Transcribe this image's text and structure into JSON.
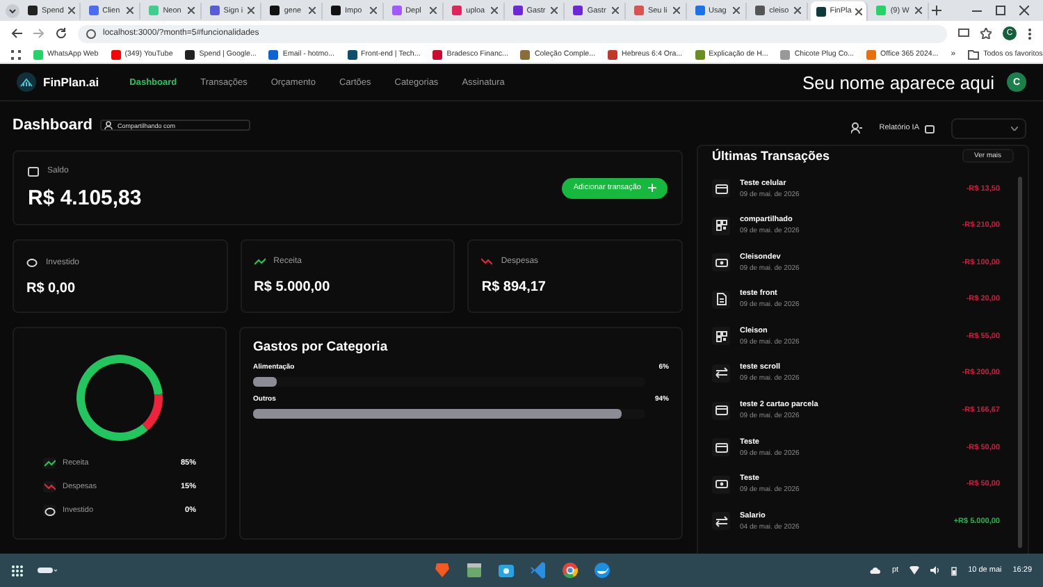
{
  "browser": {
    "tabs": [
      {
        "title": "Spend",
        "color": "#222222",
        "selected": false
      },
      {
        "title": "Clien",
        "color": "#4a6cf7",
        "selected": false
      },
      {
        "title": "Neon",
        "color": "#3ecf8e",
        "selected": false
      },
      {
        "title": "Sign i",
        "color": "#5b5bd6",
        "selected": false
      },
      {
        "title": "gene",
        "color": "#111111",
        "selected": false
      },
      {
        "title": "Impo",
        "color": "#111111",
        "selected": false
      },
      {
        "title": "Depl",
        "color": "#a259ff",
        "selected": false
      },
      {
        "title": "uploa",
        "color": "#e0245e",
        "selected": false
      },
      {
        "title": "Gastr",
        "color": "#6d28d9",
        "selected": false
      },
      {
        "title": "Gastr",
        "color": "#6d28d9",
        "selected": false
      },
      {
        "title": "Seu li",
        "color": "#d9534f",
        "selected": false
      },
      {
        "title": "Usag",
        "color": "#1a73e8",
        "selected": false
      },
      {
        "title": "cleiso",
        "color": "#555555",
        "selected": false
      },
      {
        "title": "FinPla",
        "color": "#0f3a3a",
        "selected": true
      },
      {
        "title": "(9) W",
        "color": "#25d366",
        "selected": false
      }
    ],
    "url": "localhost:3000/?month=5#funcionalidades",
    "profile": "C",
    "bookmarks": [
      {
        "label": "WhatsApp Web",
        "color": "#25d366"
      },
      {
        "label": "(349) YouTube",
        "color": "#ff0000"
      },
      {
        "label": "Spend | Google...",
        "color": "#222222"
      },
      {
        "label": "Email - hotmo...",
        "color": "#0a64d6"
      },
      {
        "label": "Front-end | Tech...",
        "color": "#0b4f6c"
      },
      {
        "label": "Bradesco Financ...",
        "color": "#cc092f"
      },
      {
        "label": "Coleção Comple...",
        "color": "#8a6d3b"
      },
      {
        "label": "Hebreus 6:4 Ora...",
        "color": "#c0392b"
      },
      {
        "label": "Explicação de H...",
        "color": "#6b8e23"
      },
      {
        "label": "Chicote Plug Co...",
        "color": "#999999"
      },
      {
        "label": "Office 365 2024...",
        "color": "#e8700a"
      }
    ],
    "more": "»",
    "all_bookmarks": "Todos os favoritos"
  },
  "app": {
    "brand": "FinPlan.ai",
    "nav": [
      {
        "label": "Dashboard",
        "selected": true
      },
      {
        "label": "Transações",
        "selected": false
      },
      {
        "label": "Orçamento",
        "selected": false
      },
      {
        "label": "Cartões",
        "selected": false
      },
      {
        "label": "Categorias",
        "selected": false
      },
      {
        "label": "Assinatura",
        "selected": false
      }
    ],
    "user_name": "Seu nome aparece aqui",
    "avatar": "C"
  },
  "header": {
    "title": "Dashboard",
    "share_placeholder": "Compartilhando com",
    "report_button": "Relatório IA"
  },
  "balance": {
    "label": "Saldo",
    "value": "R$ 4.105,83",
    "add_button": "Adicionar transação"
  },
  "summary": [
    {
      "kind": "invested",
      "label": "Investido",
      "value": "R$ 0,00"
    },
    {
      "kind": "income",
      "label": "Receita",
      "value": "R$ 5.000,00"
    },
    {
      "kind": "expense",
      "label": "Despesas",
      "value": "R$ 894,17"
    }
  ],
  "distribution": {
    "chart_data": {
      "type": "donut",
      "categories": [
        "Receita",
        "Despesas",
        "Investido"
      ],
      "values": [
        85,
        15,
        0
      ],
      "value_labels": [
        "85%",
        "15%",
        "0%"
      ],
      "legend": true
    },
    "legend_icons": [
      {
        "kind": "income"
      },
      {
        "kind": "expense"
      },
      {
        "kind": "invested"
      }
    ]
  },
  "categories": {
    "title": "Gastos por Categoria",
    "items": [
      {
        "name": "Alimentação",
        "percent": "6%",
        "level": 0.06
      },
      {
        "name": "Outros",
        "percent": "94%",
        "level": 0.94
      }
    ]
  },
  "transactions": {
    "title": "Últimas Transações",
    "more_button": "Ver mais",
    "items": [
      {
        "kind": "card",
        "name": "Teste celular",
        "date": "09 de mai. de 2026",
        "amount": "-R$ 13,50",
        "income": false
      },
      {
        "kind": "qr",
        "name": "compartilhado",
        "date": "09 de mai. de 2026",
        "amount": "-R$ 210,00",
        "income": false
      },
      {
        "kind": "cash",
        "name": "Cleisondev",
        "date": "09 de mai. de 2026",
        "amount": "-R$ 100,00",
        "income": false
      },
      {
        "kind": "doc",
        "name": "teste front",
        "date": "09 de mai. de 2026",
        "amount": "-R$ 20,00",
        "income": false
      },
      {
        "kind": "qr",
        "name": "Cleison",
        "date": "09 de mai. de 2026",
        "amount": "-R$ 55,00",
        "income": false
      },
      {
        "kind": "transfer",
        "name": "teste scroll",
        "date": "09 de mai. de 2026",
        "amount": "-R$ 200,00",
        "income": false
      },
      {
        "kind": "card",
        "name": "teste 2 cartao parcela",
        "date": "09 de mai. de 2026",
        "amount": "-R$ 166,67",
        "income": false
      },
      {
        "kind": "card",
        "name": "Teste",
        "date": "09 de mai. de 2026",
        "amount": "-R$ 50,00",
        "income": false
      },
      {
        "kind": "cash",
        "name": "Teste",
        "date": "09 de mai. de 2026",
        "amount": "-R$ 50,00",
        "income": false
      },
      {
        "kind": "transfer",
        "name": "Salario",
        "date": "04 de mai. de 2026",
        "amount": "+R$ 5.000,00",
        "income": true
      }
    ]
  },
  "taskbar": {
    "language": "pt",
    "date": "10 de mai",
    "time": "16:29"
  }
}
